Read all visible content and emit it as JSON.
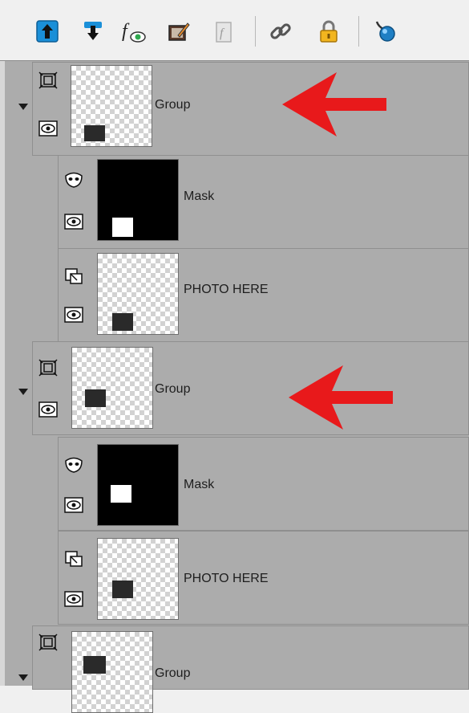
{
  "toolbar": {
    "buttons": [
      {
        "name": "move-layer-up-icon"
      },
      {
        "name": "move-layer-down-icon"
      },
      {
        "name": "layer-effects-icon"
      },
      {
        "name": "edit-layer-icon"
      },
      {
        "name": "layer-style-icon"
      },
      {
        "name": "link-icon"
      },
      {
        "name": "lock-icon"
      },
      {
        "name": "pin-icon"
      }
    ]
  },
  "layers": [
    {
      "type": "group",
      "name": "Group",
      "annotated": true
    },
    {
      "type": "mask",
      "name": "Mask"
    },
    {
      "type": "photo",
      "name": "PHOTO HERE"
    },
    {
      "type": "group",
      "name": "Group",
      "annotated": true
    },
    {
      "type": "mask",
      "name": "Mask"
    },
    {
      "type": "photo",
      "name": "PHOTO HERE"
    },
    {
      "type": "group",
      "name": "Group",
      "annotated": false
    }
  ],
  "colors": {
    "annotation_arrow": "#e8191b",
    "toolbar_accent": "#1a8fd8",
    "panel_bg": "#acacac"
  }
}
